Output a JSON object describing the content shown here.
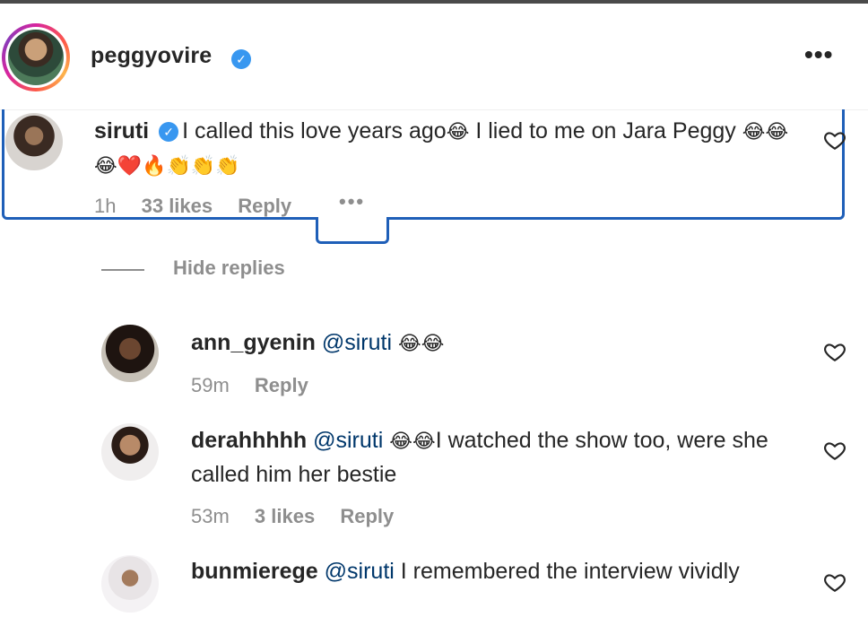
{
  "post": {
    "owner_username": "peggyovire",
    "owner_verified": true,
    "more_options_icon": "more-horizontal-icon"
  },
  "main_comment": {
    "username": "siruti",
    "verified": true,
    "text_a": "I called this love years ago",
    "emoji_a": "😂",
    "text_b": " I lied to me on Jara Peggy ",
    "emoji_b": "😂😂😂❤️🔥👏👏👏",
    "time": "1h",
    "likes": "33 likes",
    "reply_label": "Reply",
    "more_label": "•••",
    "highlight_color": "#1f5fb8"
  },
  "hide_replies_label": "Hide replies",
  "replies": [
    {
      "username": "ann_gyenin",
      "mention": "@siruti",
      "emoji": " 😂😂",
      "text": "",
      "time": "59m",
      "likes": "",
      "reply_label": "Reply"
    },
    {
      "username": "derahhhhh",
      "mention": "@siruti",
      "emoji": " 😂😂",
      "text": "I watched the show too, were she called him her bestie",
      "time": "53m",
      "likes": "3 likes",
      "reply_label": "Reply"
    },
    {
      "username": "bunmierege",
      "mention": "@siruti",
      "emoji": "",
      "text": " I remembered the interview vividly",
      "time": "",
      "likes": "",
      "reply_label": ""
    }
  ],
  "colors": {
    "text": "#262626",
    "secondary": "#8e8e8e",
    "mention": "#00376b",
    "verified": "#3897f0"
  }
}
